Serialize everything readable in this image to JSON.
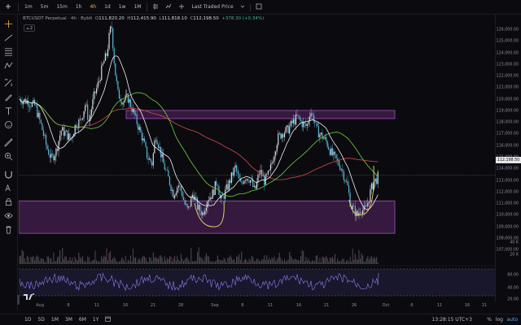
{
  "toolbar": {
    "timeframes": [
      "1m",
      "5m",
      "15m",
      "1h",
      "4h",
      "1d",
      "1w",
      "1M"
    ],
    "active_timeframe": "4h",
    "price_source_label": "Last Traded Price"
  },
  "legend": {
    "symbol": "BTCUSDT Perpetual · 4h · Bybit",
    "open_label": "O",
    "open": "111,820.20",
    "high_label": "H",
    "high": "112,415.90",
    "low_label": "L",
    "low": "111,818.10",
    "close_label": "C",
    "close": "112,198.50",
    "change": "+378.30 (+0.34%)",
    "indicator_count": "2"
  },
  "colors": {
    "candle_up": "#d5d8de",
    "candle_down": "#5bb6d8",
    "ma_white": "#f2f2f2",
    "ma_green": "#6fcf3d",
    "ma_red": "#d94a4a",
    "zone_fill": "#6b2a7a",
    "zone_border": "#b35ad0",
    "marker_curve": "#e8e36a",
    "rsi_line": "#8c7df0",
    "rsi_band": "#2a2550",
    "change_positive": "#3fb68b"
  },
  "price_axis": {
    "ticks": [
      "126,000.00",
      "125,000.00",
      "124,000.00",
      "123,000.00",
      "122,000.00",
      "121,000.00",
      "120,000.00",
      "119,000.00",
      "118,000.00",
      "117,000.00",
      "116,000.00",
      "115,000.00",
      "114,000.00",
      "113,000.00",
      "112,000.00",
      "111,000.00",
      "110,000.00",
      "109,000.00",
      "108,000.00",
      "107,000.00"
    ],
    "current_price": "112,198.50",
    "volume_ticks": [
      "40 K",
      "20 K"
    ],
    "rsi_ticks": [
      "80.00",
      "40.00",
      "20.00"
    ]
  },
  "time_axis": {
    "ticks": [
      "Aug",
      "8",
      "11",
      "16",
      "21",
      "28",
      "Sep",
      "8",
      "11",
      "16",
      "21",
      "26",
      "Oct",
      "6",
      "11",
      "16",
      "21",
      "26"
    ]
  },
  "bottom": {
    "ranges": [
      "1D",
      "5D",
      "1M",
      "3M",
      "6M",
      "1Y"
    ],
    "clock": "13:28:15 UTC+3",
    "percent_label": "%",
    "log_label": "log",
    "auto_label": "auto"
  },
  "sidebar_tools": [
    "crosshair-icon",
    "trend-line-icon",
    "fib-icon",
    "pattern-icon",
    "measure-icon",
    "brush-icon",
    "text-icon",
    "emoji-icon",
    "ruler-icon",
    "zoom-icon",
    "magnet-icon",
    "lock-draw-icon",
    "lock-icon",
    "eye-icon",
    "trash-icon"
  ],
  "chart_data": {
    "type": "candlestick",
    "price_range": [
      106200,
      126800
    ],
    "zones": [
      {
        "low": 117100,
        "high": 117800
      },
      {
        "low": 107200,
        "high": 110000
      }
    ]
  }
}
